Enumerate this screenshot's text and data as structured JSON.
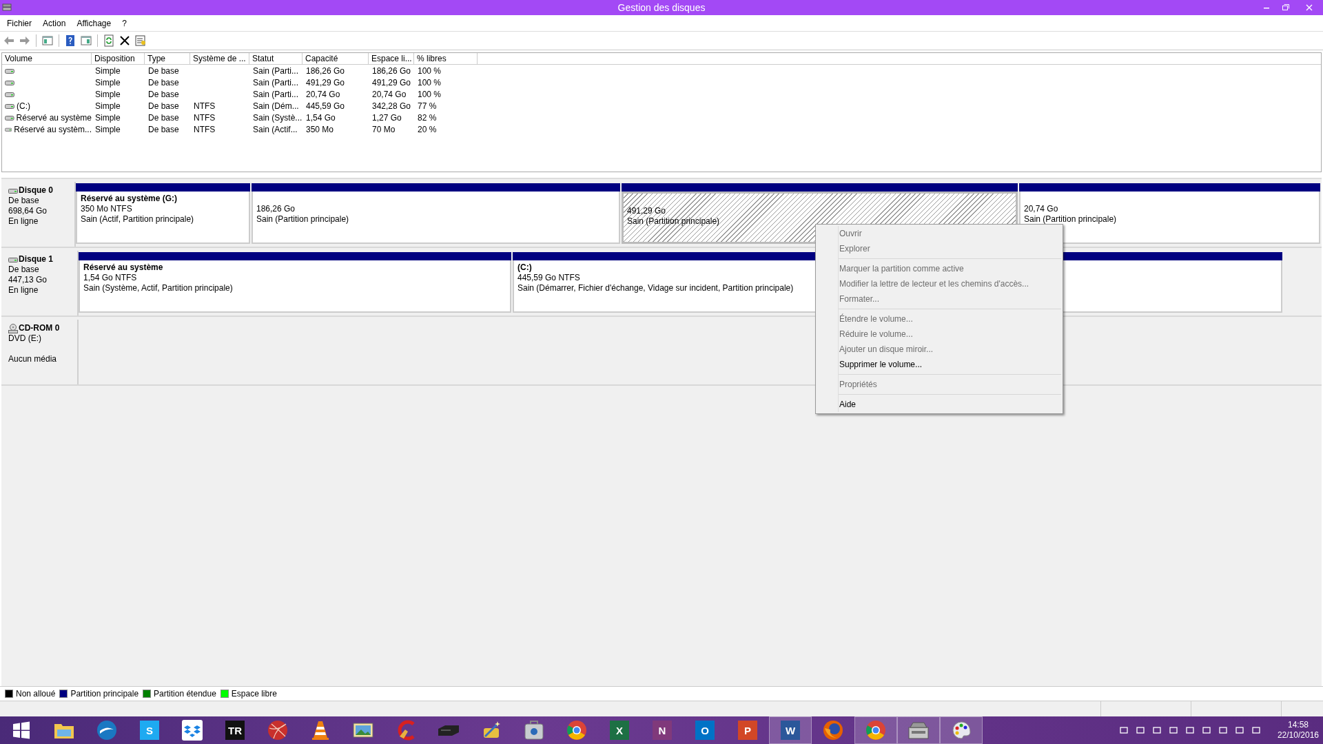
{
  "window": {
    "title": "Gestion des disques"
  },
  "menu": [
    "Fichier",
    "Action",
    "Affichage",
    "?"
  ],
  "toolbar": [
    {
      "kind": "back",
      "disabled": true
    },
    {
      "kind": "forward",
      "disabled": true
    },
    {
      "kind": "sep"
    },
    {
      "kind": "tree"
    },
    {
      "kind": "sep"
    },
    {
      "kind": "help"
    },
    {
      "kind": "pane"
    },
    {
      "kind": "sep"
    },
    {
      "kind": "refresh"
    },
    {
      "kind": "delete"
    },
    {
      "kind": "properties"
    }
  ],
  "table": {
    "columns": [
      "Volume",
      "Disposition",
      "Type",
      "Système de ...",
      "Statut",
      "Capacité",
      "Espace li...",
      "% libres"
    ],
    "rows": [
      [
        "",
        "Simple",
        "De base",
        "",
        "Sain (Parti...",
        "186,26 Go",
        "186,26 Go",
        "100 %"
      ],
      [
        "",
        "Simple",
        "De base",
        "",
        "Sain (Parti...",
        "491,29 Go",
        "491,29 Go",
        "100 %"
      ],
      [
        "",
        "Simple",
        "De base",
        "",
        "Sain (Parti...",
        "20,74 Go",
        "20,74 Go",
        "100 %"
      ],
      [
        " (C:)",
        "Simple",
        "De base",
        "NTFS",
        "Sain (Dém...",
        "445,59 Go",
        "342,28 Go",
        "77 %"
      ],
      [
        "Réservé au système",
        "Simple",
        "De base",
        "NTFS",
        "Sain (Systè...",
        "1,54 Go",
        "1,27 Go",
        "82 %"
      ],
      [
        "Réservé au systèm...",
        "Simple",
        "De base",
        "NTFS",
        "Sain (Actif...",
        "350 Mo",
        "70 Mo",
        "20 %"
      ]
    ]
  },
  "disks": [
    {
      "kind": "disk",
      "name": "Disque 0",
      "lines": [
        "De base",
        "698,64 Go",
        "En ligne"
      ],
      "partitions": [
        {
          "name": "Réservé au système  (G:)",
          "size": "350 Mo NTFS",
          "status": "Sain (Actif, Partition principale)",
          "selected": false
        },
        {
          "size": "186,26 Go",
          "status": "Sain (Partition principale)",
          "selected": false
        },
        {
          "size": "491,29 Go",
          "status": "Sain (Partition principale)",
          "selected": true
        },
        {
          "size": "20,74 Go",
          "status": "Sain (Partition principale)",
          "selected": false
        }
      ]
    },
    {
      "kind": "disk",
      "name": "Disque 1",
      "lines": [
        "De base",
        "447,13 Go",
        "En ligne"
      ],
      "partitions": [
        {
          "name": "Réservé au système",
          "size": "1,54 Go NTFS",
          "status": "Sain (Système, Actif, Partition principale)",
          "selected": false
        },
        {
          "name": " (C:)",
          "size": "445,59 Go NTFS",
          "status": "Sain (Démarrer, Fichier d'échange, Vidage sur incident, Partition principale)",
          "selected": false
        }
      ]
    },
    {
      "kind": "cdrom",
      "name": "CD-ROM 0",
      "lines": [
        "DVD (E:)",
        "Aucun média"
      ]
    }
  ],
  "context_menu": [
    {
      "kind": "item",
      "label": "Ouvrir",
      "disabled": true
    },
    {
      "kind": "item",
      "label": "Explorer",
      "disabled": true
    },
    {
      "kind": "separator"
    },
    {
      "kind": "item",
      "label": "Marquer la partition comme active",
      "disabled": true
    },
    {
      "kind": "item",
      "label": "Modifier la lettre de lecteur et les chemins d'accès...",
      "disabled": true
    },
    {
      "kind": "item",
      "label": "Formater...",
      "disabled": true
    },
    {
      "kind": "separator"
    },
    {
      "kind": "item",
      "label": "Étendre le volume...",
      "disabled": true
    },
    {
      "kind": "item",
      "label": "Réduire le volume...",
      "disabled": true
    },
    {
      "kind": "item",
      "label": "Ajouter un disque miroir...",
      "disabled": true
    },
    {
      "kind": "item",
      "label": "Supprimer le volume...",
      "disabled": false
    },
    {
      "kind": "separator"
    },
    {
      "kind": "item",
      "label": "Propriétés",
      "disabled": true
    },
    {
      "kind": "separator"
    },
    {
      "kind": "item",
      "label": "Aide",
      "disabled": false
    }
  ],
  "legend": [
    {
      "label": "Non alloué",
      "color": "#000000"
    },
    {
      "label": "Partition principale",
      "color": "#000080"
    },
    {
      "label": "Partition étendue",
      "color": "#008000"
    },
    {
      "label": "Espace libre",
      "color": "#00ff00"
    }
  ],
  "taskbar": {
    "apps": [
      {
        "kind": "start",
        "active": false
      },
      {
        "kind": "folder",
        "active": false
      },
      {
        "kind": "bird",
        "active": false
      },
      {
        "kind": "tile",
        "glyph": "S",
        "color": "#1eaaf1",
        "active": false
      },
      {
        "kind": "dropbox",
        "active": false
      },
      {
        "kind": "tile",
        "glyph": "TR",
        "color": "#111111",
        "active": false
      },
      {
        "kind": "ball",
        "active": false
      },
      {
        "kind": "cone",
        "active": false
      },
      {
        "kind": "photo",
        "active": false
      },
      {
        "kind": "broom",
        "active": false
      },
      {
        "kind": "printer",
        "active": false
      },
      {
        "kind": "wand",
        "active": false
      },
      {
        "kind": "case",
        "active": false
      },
      {
        "kind": "chrome",
        "active": false
      },
      {
        "kind": "tile",
        "glyph": "X",
        "color": "#1d7044",
        "active": false
      },
      {
        "kind": "tile",
        "glyph": "N",
        "color": "#80397b",
        "active": false
      },
      {
        "kind": "tile",
        "glyph": "O",
        "color": "#0072c6",
        "active": false
      },
      {
        "kind": "tile",
        "glyph": "P",
        "color": "#d24726",
        "active": false
      },
      {
        "kind": "tile",
        "glyph": "W",
        "color": "#2b579a",
        "active": true
      },
      {
        "kind": "firefox",
        "active": false
      },
      {
        "kind": "chrome",
        "active": true
      },
      {
        "kind": "diskmgmt",
        "active": true
      },
      {
        "kind": "palette",
        "active": true
      }
    ],
    "time": "14:58",
    "date": "22/10/2016"
  }
}
